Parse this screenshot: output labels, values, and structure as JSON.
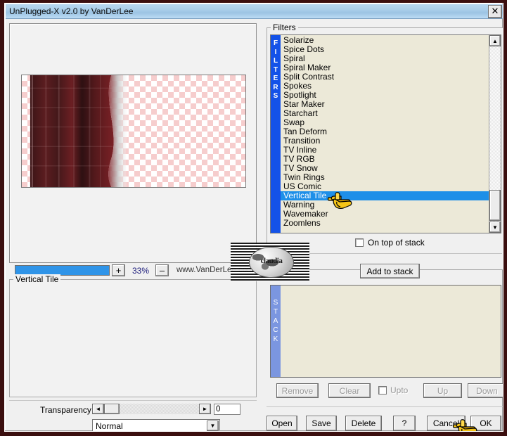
{
  "window": {
    "title": "UnPlugged-X v2.0 by VanDerLee",
    "close_label": "✕"
  },
  "preview": {
    "zoom_value": "33%",
    "zoom_in_label": "+",
    "zoom_out_label": "–",
    "url": "www.VanDerLee.com"
  },
  "params": {
    "group_legend": "Vertical Tile",
    "transparency_label": "Transparency",
    "transparency_value": "0",
    "slider_left_label": "◄",
    "slider_right_label": "►",
    "blend_mode": "Normal",
    "blend_arrow": "▼"
  },
  "filters": {
    "group_legend": "Filters",
    "side_label": "FILTERS",
    "selected": "Vertical Tile",
    "items": [
      "Solarize",
      "Spice Dots",
      "Spiral",
      "Spiral Maker",
      "Split Contrast",
      "Spokes",
      "Spotlight",
      "Star Maker",
      "Starchart",
      "Swap",
      "Tan Deform",
      "Transition",
      "TV Inline",
      "TV RGB",
      "TV Snow",
      "Twin Rings",
      "US Comic",
      "Vertical Tile",
      "Warning",
      "Wavemaker",
      "Zoomlens"
    ],
    "scroll_up_label": "▲",
    "scroll_down_label": "▼",
    "on_top_of_stack_label": "On top of stack",
    "on_top_of_stack_checked": false,
    "add_to_stack_label": "Add to stack"
  },
  "stack": {
    "side_label": "STACK",
    "items": [],
    "remove_label": "Remove",
    "clear_label": "Clear",
    "upto_label": "Upto",
    "upto_checked": false,
    "up_label": "Up",
    "down_label": "Down"
  },
  "bottom": {
    "open_label": "Open",
    "save_label": "Save",
    "delete_label": "Delete",
    "help_label": "?",
    "cancel_label": "Cancel",
    "ok_label": "OK"
  },
  "watermark": {
    "text": "claudia"
  },
  "colors": {
    "titlebar": "#9cc4e4",
    "filters_bar": "#1452e8",
    "stack_bar": "#7b96e0",
    "selection": "#1e8fe8",
    "listbox_bg": "#ece9d8",
    "zoom_fill": "#2f94e8",
    "frame_outer": "#3b0f0f"
  }
}
